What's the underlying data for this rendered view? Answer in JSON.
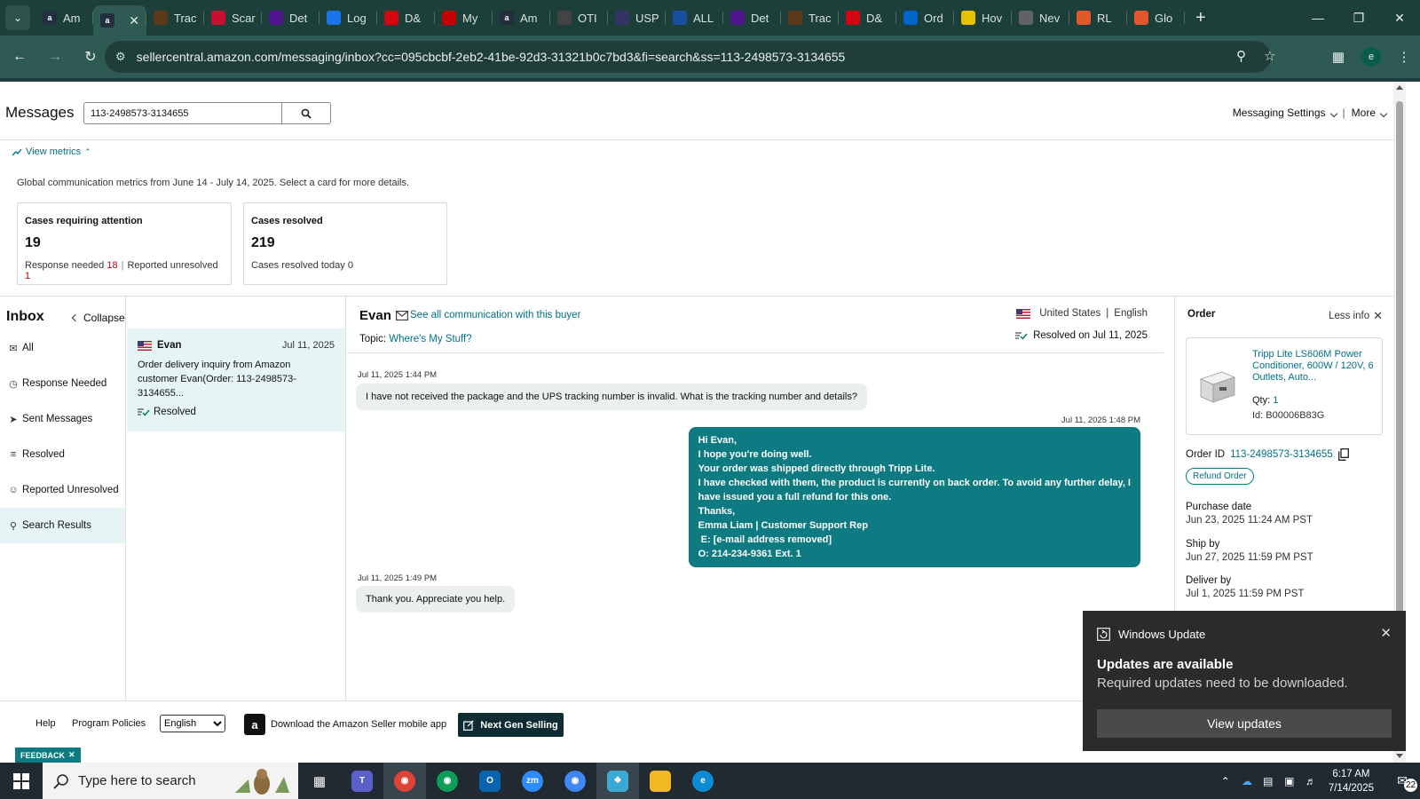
{
  "browser": {
    "tabs": [
      {
        "label": "Am",
        "icon": "amazon-icon",
        "color": "#232f3e"
      },
      {
        "label": "",
        "icon": "amazon-icon",
        "color": "#232f3e",
        "active": true
      },
      {
        "label": "Trac",
        "icon": "ups-icon",
        "color": "#5c3a1a"
      },
      {
        "label": "Scar",
        "icon": "scale-icon",
        "color": "#c8102e"
      },
      {
        "label": "Det",
        "icon": "fedex-icon",
        "color": "#4d148c"
      },
      {
        "label": "Log",
        "icon": "login-icon",
        "color": "#1a73e8"
      },
      {
        "label": "D&",
        "icon": "dh-icon",
        "color": "#d40511"
      },
      {
        "label": "My",
        "icon": "my-icon",
        "color": "#c40000"
      },
      {
        "label": "Am",
        "icon": "amazon-icon",
        "color": "#232f3e"
      },
      {
        "label": "OTI",
        "icon": "oti-icon",
        "color": "#444"
      },
      {
        "label": "USP",
        "icon": "usps-icon",
        "color": "#333366"
      },
      {
        "label": "ALL",
        "icon": "17track-icon",
        "color": "#1a4fa0"
      },
      {
        "label": "Det",
        "icon": "fedex-icon",
        "color": "#4d148c"
      },
      {
        "label": "Trac",
        "icon": "ups-icon",
        "color": "#5c3a1a"
      },
      {
        "label": "D&",
        "icon": "dh-icon",
        "color": "#d40511"
      },
      {
        "label": "Ord",
        "icon": "ec-icon",
        "color": "#0066cc"
      },
      {
        "label": "Hov",
        "icon": "chrome-ext-icon",
        "color": "#e6c200"
      },
      {
        "label": "Nev",
        "icon": "chrome-icon",
        "color": "#5f6368"
      },
      {
        "label": "RL",
        "icon": "rl-icon",
        "color": "#e2582b"
      },
      {
        "label": "Glo",
        "icon": "glo-icon",
        "color": "#e2582b"
      }
    ],
    "url": "sellercentral.amazon.com/messaging/inbox?cc=095cbcbf-2eb2-41be-92d3-31321b0c7bd3&fi=search&ss=113-2498573-3134655",
    "profile_initial": "e"
  },
  "header": {
    "title": "Messages",
    "search_value": "113-2498573-3134655",
    "messaging_settings": "Messaging Settings",
    "separator": "|",
    "more": "More"
  },
  "metrics": {
    "toggle_label": "View metrics",
    "description": "Global communication metrics from June 14 - July 14, 2025. Select a card for more details.",
    "cards": [
      {
        "title": "Cases requiring attention",
        "value": "19",
        "sub1_label": "Response needed",
        "sub1_value": "18",
        "sub2_label": "Reported unresolved",
        "sub2_value": "1"
      },
      {
        "title": "Cases resolved",
        "value": "219",
        "sub_label": "Cases resolved today 0"
      }
    ]
  },
  "sidebar": {
    "title": "Inbox",
    "collapse": "Collapse",
    "items": [
      {
        "label": "All",
        "icon": "envelope-icon"
      },
      {
        "label": "Response Needed",
        "icon": "clock-icon"
      },
      {
        "label": "Sent Messages",
        "icon": "send-icon"
      },
      {
        "label": "Resolved",
        "icon": "resolved-icon"
      },
      {
        "label": "Reported Unresolved",
        "icon": "report-icon"
      },
      {
        "label": "Search Results",
        "icon": "search-icon",
        "selected": true
      }
    ]
  },
  "thread": {
    "name": "Evan",
    "date": "Jul 11, 2025",
    "preview": "Order delivery inquiry from Amazon customer Evan(Order: 113-2498573-3134655...",
    "status": "Resolved"
  },
  "conversation": {
    "buyer": "Evan",
    "see_all": "See all communication with this buyer",
    "topic_label": "Topic:",
    "topic_value": "Where's My Stuff?",
    "country": "United States",
    "language": "English",
    "resolved_on": "Resolved on Jul 11, 2025",
    "messages": [
      {
        "time": "Jul 11, 2025 1:44 PM",
        "text": "I have not received the package and the UPS tracking number is invalid. What is the tracking number and details?"
      },
      {
        "time": "Jul 11, 2025 1:48 PM",
        "lines": [
          "Hi Evan,",
          "I hope you're doing well.",
          "Your order was shipped directly through Tripp Lite.",
          "I have checked with them, the product is currently on back order. To avoid any further delay, I",
          "have issued you a full refund for this one.",
          "Thanks,",
          "Emma Liam | Customer Support Rep",
          " E: [e-mail address removed]",
          "O: 214-234-9361 Ext. 1"
        ]
      },
      {
        "time": "Jul 11, 2025 1:49 PM",
        "text": "Thank you. Appreciate you help."
      }
    ]
  },
  "order": {
    "title": "Order",
    "less_info": "Less info",
    "product_name": "Tripp Lite LS606M Power Conditioner, 600W / 120V, 6 Outlets, Auto...",
    "qty_label": "Qty:",
    "qty_value": "1",
    "id_label": "Id: B00006B83G",
    "order_id_label": "Order ID",
    "order_id": "113-2498573-3134655",
    "refund_button": "Refund Order",
    "purchase_date_label": "Purchase date",
    "purchase_date": "Jun 23, 2025 11:24 AM PST",
    "ship_by_label": "Ship by",
    "ship_by": "Jun 27, 2025 11:59 PM PST",
    "deliver_by_label": "Deliver by",
    "deliver_by": "Jul 1, 2025 11:59 PM PST"
  },
  "footer": {
    "help": "Help",
    "program_policies": "Program Policies",
    "language": "English",
    "download_app": "Download the Amazon Seller mobile app",
    "next_gen": "Next Gen Selling",
    "feedback": "FEEDBACK"
  },
  "toast": {
    "app": "Windows Update",
    "title": "Updates are available",
    "body": "Required updates need to be downloaded.",
    "button": "View updates"
  },
  "taskbar": {
    "search_placeholder": "Type here to search",
    "time": "6:17 AM",
    "date": "7/14/2025",
    "notifications": "22"
  },
  "colors": {
    "teal_link": "#007185",
    "teal_bubble": "#0e7a82",
    "alert_red": "#c40000",
    "browser_dark": "#1d3f3a",
    "browser_mid": "#2e5a53"
  }
}
